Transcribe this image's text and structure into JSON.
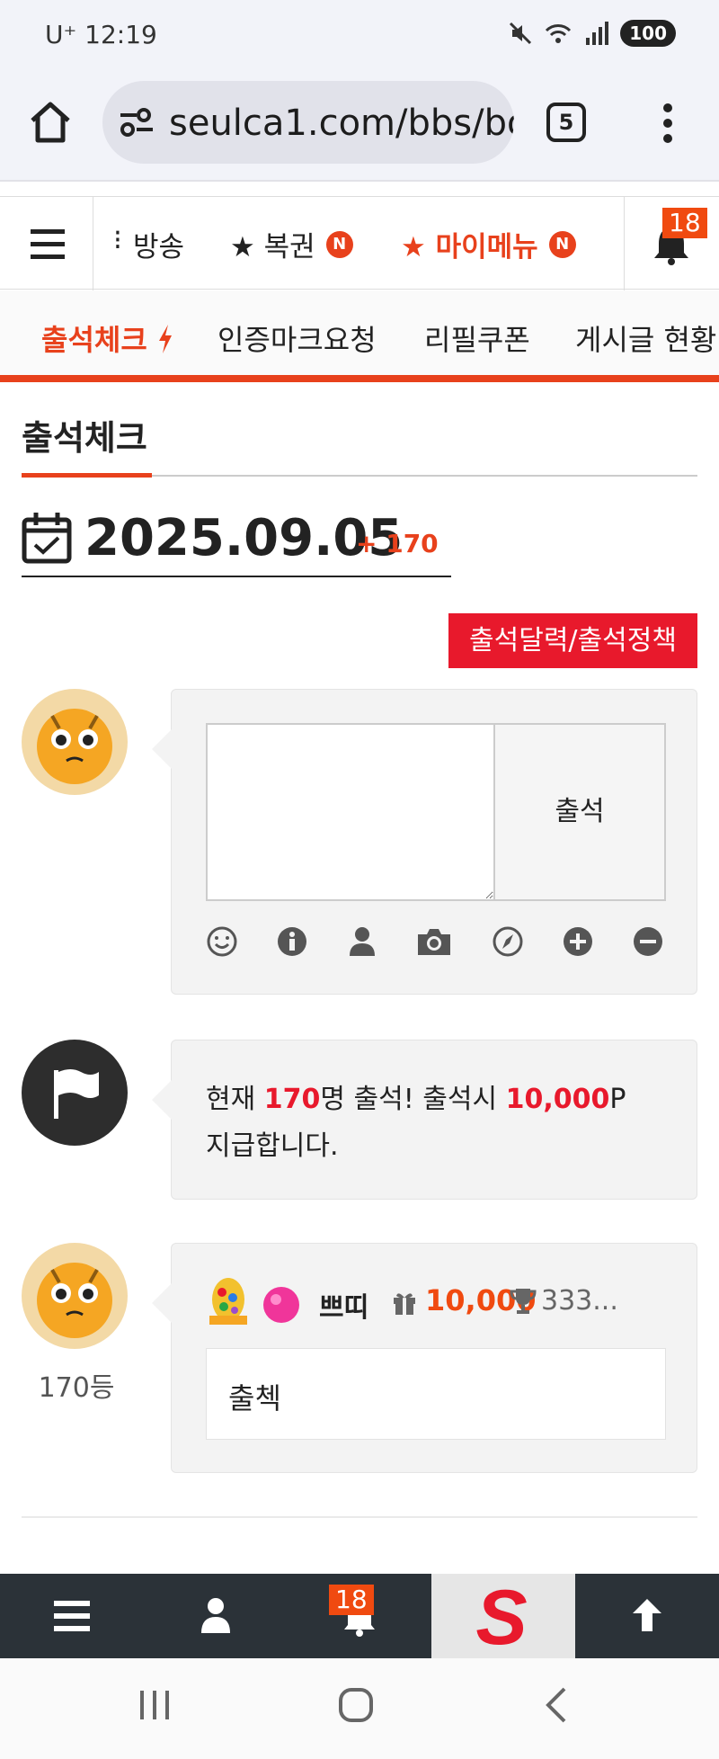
{
  "status_bar": {
    "carrier": "U⁺ 12:19",
    "battery": "100"
  },
  "browser": {
    "url": "seulca1.com/bbs/bo",
    "tab_count": "5"
  },
  "top_nav": {
    "items": [
      {
        "label": "방송",
        "badge": ""
      },
      {
        "label": "★ 복권",
        "badge": "N"
      },
      {
        "label": "★ 마이메뉴",
        "badge": "N"
      }
    ],
    "notification_count": "18",
    "active_color": "#e8411c"
  },
  "sub_nav": {
    "items": [
      "출석체크",
      "인증마크요청",
      "리필쿠폰",
      "게시글 현황"
    ]
  },
  "page": {
    "title": "출석체크",
    "date": "2025.09.05",
    "date_count": "+ 170",
    "policy_button": "출석달력/출석정책"
  },
  "attend_form": {
    "textarea_value": "",
    "submit_label": "출석",
    "tools": [
      "smile-icon",
      "info-icon",
      "user-icon",
      "camera-icon",
      "compass-icon",
      "plus-circle-icon",
      "minus-circle-icon"
    ]
  },
  "notice": {
    "prefix": "현재 ",
    "count": "170",
    "middle": "명 출석! 출석시 ",
    "points": "10,000",
    "suffix": "P 지급합니다."
  },
  "entry": {
    "rank": "170등",
    "username": "쁘띠",
    "points": "10,000",
    "trophy": "333...",
    "comment": "출첵"
  },
  "bottom_bar": {
    "notification_count": "18",
    "logo_letter": "S"
  }
}
